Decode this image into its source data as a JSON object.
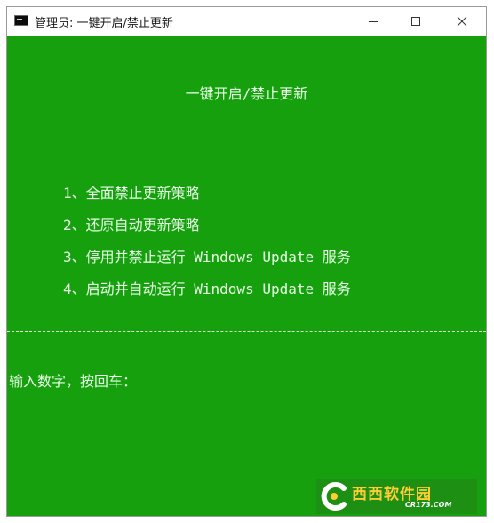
{
  "window": {
    "title": "管理员: 一键开启/禁止更新",
    "icon": "console-icon",
    "controls": [
      "minimize",
      "maximize",
      "close"
    ]
  },
  "console": {
    "heading": "一键开启/禁止更新",
    "divider": "----------------------------------------------------------------",
    "menu": [
      "1、全面禁止更新策略",
      "2、还原自动更新策略",
      "3、停用并禁止运行 Windows Update 服务",
      "4、启动并自动运行 Windows Update 服务"
    ],
    "prompt": "输入数字，按回车："
  },
  "watermark": {
    "brand": "西西软件园",
    "domain": "CR173.COM"
  },
  "colors": {
    "console_background": "#17a00e",
    "console_text": "#e6ffe6",
    "titlebar": "#ffffff"
  }
}
